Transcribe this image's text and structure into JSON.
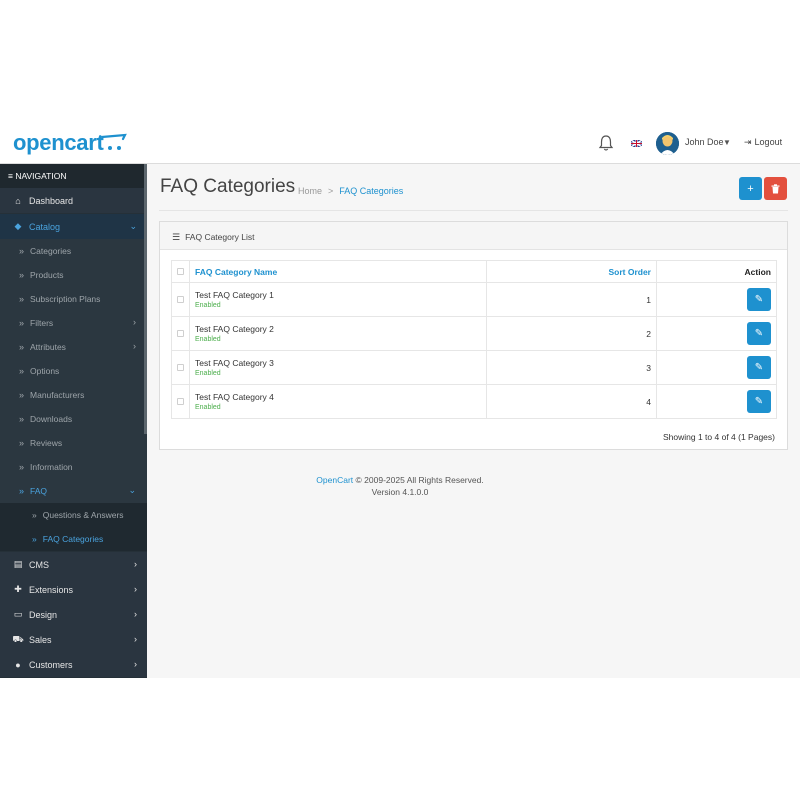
{
  "header": {
    "logo_text": "opencart",
    "user_name": "John Doe",
    "logout_label": "Logout",
    "logout_icon": "⇥"
  },
  "sidebar": {
    "title": "≡ NAVIGATION",
    "items": [
      {
        "label": "Dashboard",
        "icon": "home-icon"
      },
      {
        "label": "Catalog",
        "icon": "tag-icon"
      },
      {
        "label": "CMS",
        "icon": "newspaper-icon"
      },
      {
        "label": "Extensions",
        "icon": "puzzle-icon"
      },
      {
        "label": "Design",
        "icon": "monitor-icon"
      },
      {
        "label": "Sales",
        "icon": "cart-icon"
      },
      {
        "label": "Customers",
        "icon": "user-icon"
      }
    ],
    "catalog_children": [
      "Categories",
      "Products",
      "Subscription Plans",
      "Filters",
      "Attributes",
      "Options",
      "Manufacturers",
      "Downloads",
      "Reviews",
      "Information",
      "FAQ"
    ],
    "faq_children": [
      "Questions & Answers",
      "FAQ Categories"
    ]
  },
  "page": {
    "title": "FAQ Categories",
    "breadcrumb_home": "Home",
    "breadcrumb_sep": ">",
    "breadcrumb_current": "FAQ Categories",
    "add_label": "+",
    "delete_label": "🗑"
  },
  "card": {
    "title": "FAQ Category List",
    "columns": {
      "name": "FAQ Category Name",
      "sort": "Sort Order",
      "action": "Action"
    },
    "rows": [
      {
        "name": "Test FAQ Category 1",
        "status": "Enabled",
        "sort": "1"
      },
      {
        "name": "Test FAQ Category 2",
        "status": "Enabled",
        "sort": "2"
      },
      {
        "name": "Test FAQ Category 3",
        "status": "Enabled",
        "sort": "3"
      },
      {
        "name": "Test FAQ Category 4",
        "status": "Enabled",
        "sort": "4"
      }
    ],
    "pagination": "Showing 1 to 4 of 4 (1 Pages)"
  },
  "footer": {
    "brand": "OpenCart",
    "copyright": "© 2009-2025 All Rights Reserved.",
    "version": "Version 4.1.0.0"
  },
  "colors": {
    "accent": "#1e91cf",
    "danger": "#e3503e",
    "success": "#4cae4c",
    "sidebar_bg": "#253038"
  }
}
